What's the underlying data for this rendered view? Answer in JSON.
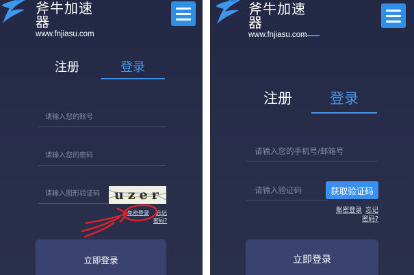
{
  "brand": {
    "title": "斧牛加速器",
    "url": "www.fnjiasu.com",
    "accent": "#3f97ec",
    "menu_icon": "hamburger-menu-icon"
  },
  "left": {
    "tabs": [
      {
        "label": "注册",
        "active": false
      },
      {
        "label": "登录",
        "active": true
      }
    ],
    "account_placeholder": "请输入您的账号",
    "password_placeholder": "请输入您的密码",
    "captcha_placeholder": "请输入图形验证码",
    "captcha_image_text": "uzer",
    "passwordless_login": "免密登录",
    "forgot_line1": "忘记",
    "forgot_line2": "密码?",
    "login_button": "立即登录"
  },
  "right": {
    "tabs": [
      {
        "label": "注册",
        "active": false
      },
      {
        "label": "登录",
        "active": true
      }
    ],
    "phone_email_placeholder": "请输入您的手机号/邮箱号",
    "code_placeholder": "请输入验证码",
    "get_code_button": "获取验证码",
    "password_login": "账密登录",
    "forgot_line1": "忘记",
    "forgot_line2": "密码?",
    "login_button": "立即登录"
  },
  "annotation_color": "#e0202a"
}
